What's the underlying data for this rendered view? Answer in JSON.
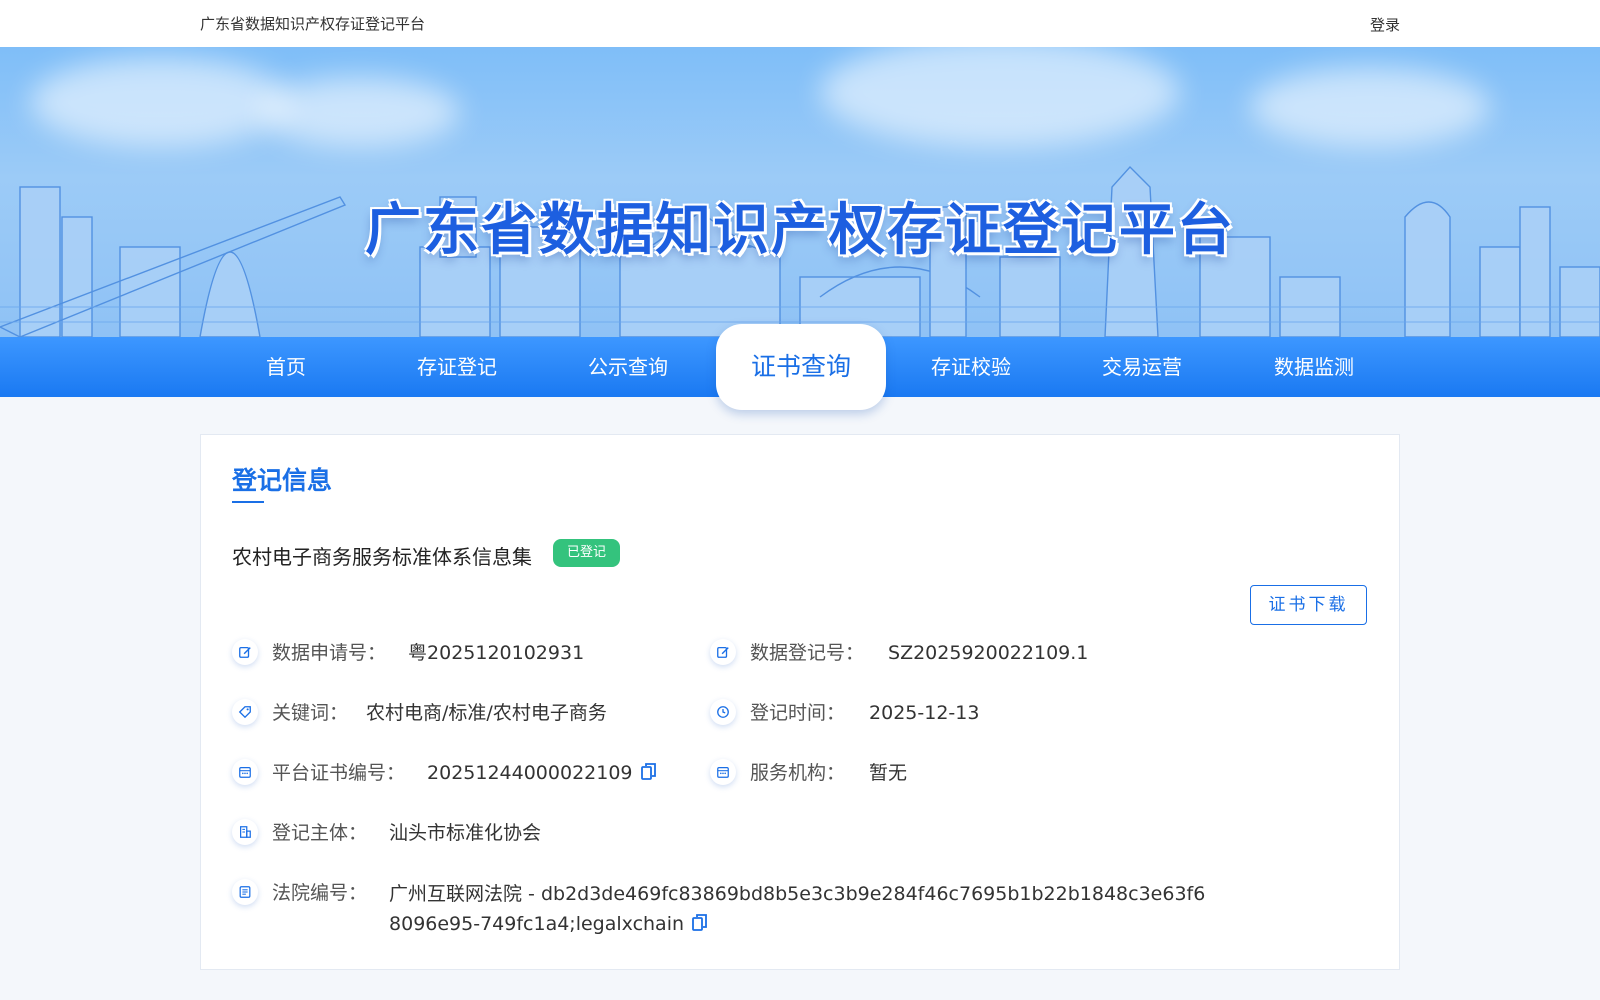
{
  "topbar": {
    "site_name": "广东省数据知识产权存证登记平台",
    "login": "登录"
  },
  "banner": {
    "title": "广东省数据知识产权存证登记平台"
  },
  "nav": {
    "items": [
      {
        "label": "首页"
      },
      {
        "label": "存证登记"
      },
      {
        "label": "公示查询"
      },
      {
        "label": "证书查询",
        "active": true
      },
      {
        "label": "存证校验"
      },
      {
        "label": "交易运营"
      },
      {
        "label": "数据监测"
      }
    ]
  },
  "card": {
    "section_title": "登记信息",
    "item_name": "农村电子商务服务标准体系信息集",
    "status_badge": "已登记",
    "download_button": "证书下载",
    "fields": {
      "apply_no": {
        "label": "数据申请号：",
        "value": "粤2025120102931"
      },
      "reg_no": {
        "label": "数据登记号：",
        "value": "SZ2025920022109.1"
      },
      "keywords": {
        "label": "关键词：",
        "value": "农村电商/标准/农村电子商务"
      },
      "reg_time": {
        "label": "登记时间：",
        "value": "2025-12-13"
      },
      "cert_no": {
        "label": "平台证书编号：",
        "value": "20251244000022109"
      },
      "service_org": {
        "label": "服务机构：",
        "value": "暂无"
      },
      "subject": {
        "label": "登记主体：",
        "value": "汕头市标准化协会"
      },
      "court_no": {
        "label": "法院编号：",
        "value": "广州互联网法院 - db2d3de469fc83869bd8b5e3c3b9e284f46c7695b1b22b1848c3e63f68096e95-749fc1a4;legalxchain"
      }
    }
  },
  "colors": {
    "accent": "#1a6fe6",
    "badge_green": "#34c37d",
    "nav_blue": "#2f88fb"
  }
}
